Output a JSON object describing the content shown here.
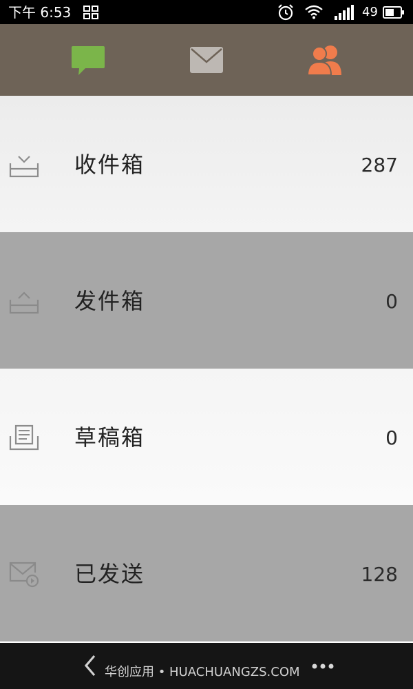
{
  "status_bar": {
    "time": "下午 6:53",
    "battery_level": "49",
    "icons": [
      "app-grid-icon",
      "alarm-clock-icon",
      "wifi-icon",
      "cell-signal-icon",
      "battery-icon"
    ]
  },
  "tabs": [
    {
      "name": "messages",
      "icon": "chat-bubble-icon",
      "color": "#7bb54a"
    },
    {
      "name": "mail",
      "icon": "envelope-icon",
      "color": "#bdb8b3",
      "active": true
    },
    {
      "name": "contacts",
      "icon": "people-icon",
      "color": "#f07c4c"
    }
  ],
  "folders": [
    {
      "label": "收件箱",
      "count": "287",
      "icon": "inbox-icon"
    },
    {
      "label": "发件箱",
      "count": "0",
      "icon": "outbox-icon"
    },
    {
      "label": "草稿箱",
      "count": "0",
      "icon": "drafts-icon"
    },
    {
      "label": "已发送",
      "count": "128",
      "icon": "sent-mail-icon"
    }
  ],
  "bottom_bar": {
    "caption": "华创应用 • HUACHUANGZS.COM",
    "icons": [
      "back-chevron-icon",
      "more-dots-icon"
    ]
  },
  "colors": {
    "tab_bar": "#6e6357",
    "row_dark": "#a7a7a7",
    "row_light": "#efefef",
    "bottom_bar": "#151515"
  }
}
